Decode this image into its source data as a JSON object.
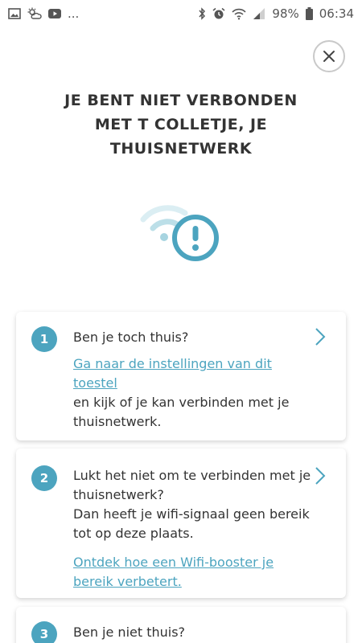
{
  "status_bar": {
    "battery": "98%",
    "time": "06:34",
    "notif_more": "..."
  },
  "header": {
    "title": "JE BENT NIET VERBONDEN MET T COLLETJE, JE THUISNETWERK"
  },
  "colors": {
    "accent": "#4ca4bf",
    "text": "#333333"
  },
  "cards": [
    {
      "number": "1",
      "title": "Ben je toch thuis?",
      "link": "Ga naar de instellingen van dit toestel",
      "text": "en kijk of je kan verbinden met je thuisnetwerk."
    },
    {
      "number": "2",
      "title": "Lukt het niet om te verbinden met je thuisnetwerk?",
      "text": "Dan heeft je wifi-signaal geen bereik tot op deze plaats.",
      "link": "Ontdek hoe een Wifi-booster je bereik verbetert."
    },
    {
      "number": "3",
      "title": "Ben je niet thuis?"
    }
  ]
}
